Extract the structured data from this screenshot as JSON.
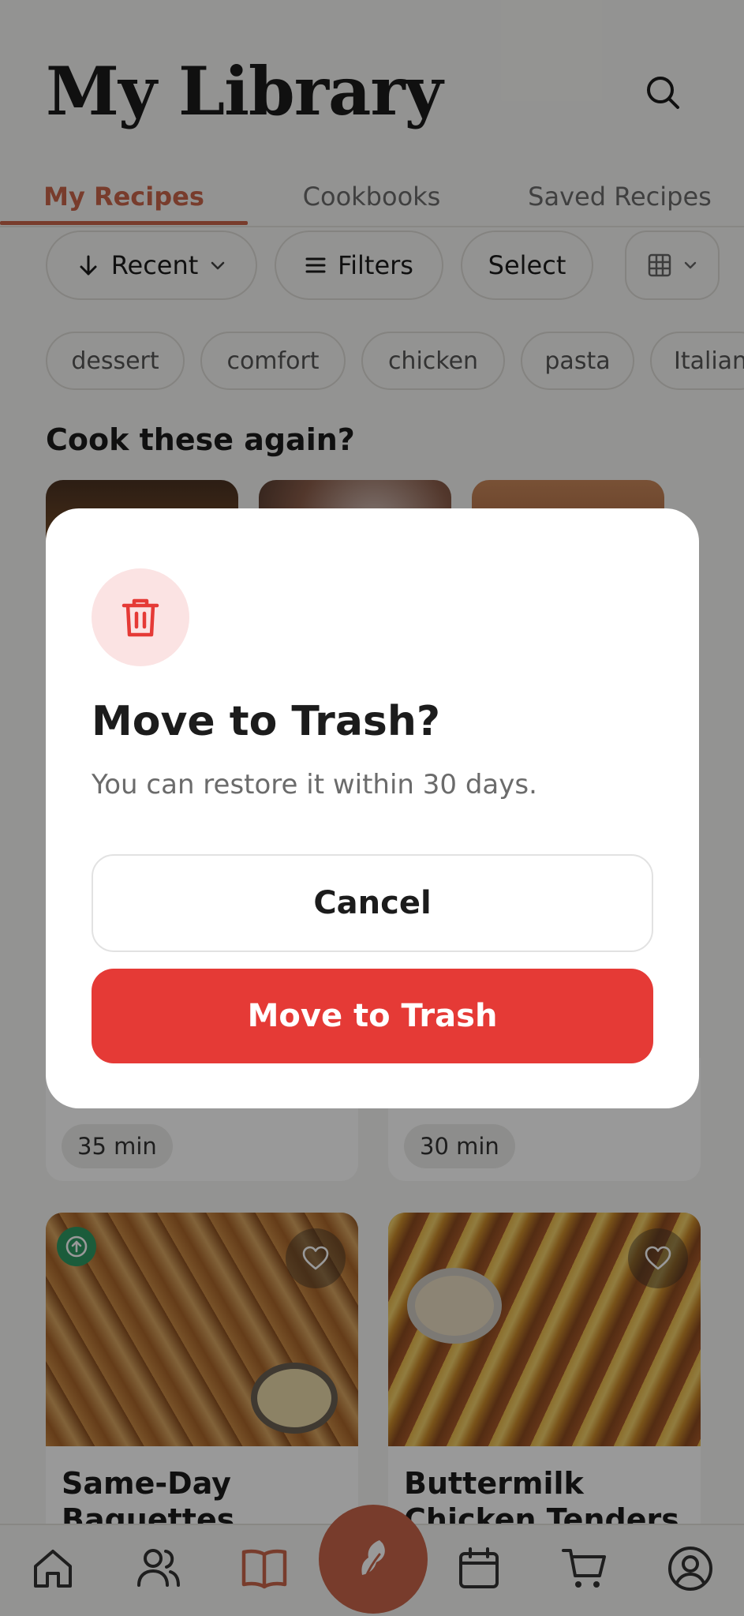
{
  "header": {
    "title": "My Library",
    "search_icon": "search-icon"
  },
  "tabs": [
    {
      "label": "My Recipes",
      "active": true
    },
    {
      "label": "Cookbooks",
      "active": false
    },
    {
      "label": "Saved Recipes",
      "active": false
    }
  ],
  "toolbar": {
    "sort_label": "Recent",
    "filters_label": "Filters",
    "select_label": "Select",
    "view_icon": "grid-icon"
  },
  "tags": [
    "dessert",
    "comfort",
    "chicken",
    "pasta",
    "Italian"
  ],
  "section": {
    "cook_again_title": "Cook these again?"
  },
  "recipe_cards": [
    {
      "time": "35 min"
    },
    {
      "time": "30 min"
    },
    {
      "title": "Same-Day Baguettes"
    },
    {
      "title": "Buttermilk Chicken Tenders"
    }
  ],
  "bottom_nav": {
    "items": [
      "home-icon",
      "people-icon",
      "book-icon",
      "leaf-icon",
      "calendar-icon",
      "cart-icon",
      "profile-icon"
    ],
    "active": "book-icon"
  },
  "dialog": {
    "title": "Move to Trash?",
    "message": "You can restore it within 30 days.",
    "cancel_label": "Cancel",
    "confirm_label": "Move to Trash"
  },
  "colors": {
    "accent": "#c8654a",
    "danger": "#e53a36",
    "danger_soft": "#fbe3e3",
    "badge_green": "#2e9a63"
  }
}
